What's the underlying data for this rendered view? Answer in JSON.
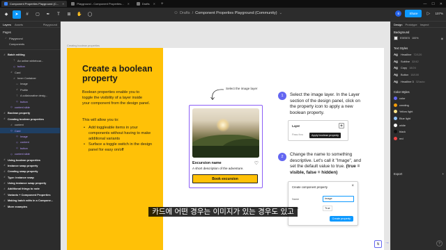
{
  "browser": {
    "tabs": [
      {
        "label": "Component Properties Playground (C...",
        "active": true
      },
      {
        "label": "Playground - Component Properties...",
        "active": false
      },
      {
        "label": "Drafts",
        "active": false
      }
    ]
  },
  "toolbar": {
    "breadcrumb_parent": "Drafts",
    "breadcrumb_separator": "/",
    "file_name": "Component Properties Playground (Community)",
    "avatar_initial": "E",
    "share_label": "Share",
    "zoom": "107%"
  },
  "layers_panel": {
    "tab_layers": "Layers",
    "tab_assets": "Assets",
    "page_label": "Playground",
    "pages_title": "Pages",
    "pages": [
      "Playground",
      "Components"
    ],
    "rows": [
      {
        "label": "Batch editing",
        "style": "bold",
        "indent": 0,
        "icon": "#"
      },
      {
        "label": "An online whiteboar...",
        "style": "",
        "indent": 14,
        "icon": "T"
      },
      {
        "label": "button",
        "style": "purple",
        "indent": 14,
        "icon": "◇"
      },
      {
        "label": "Card",
        "style": "",
        "indent": 10,
        "icon": "#"
      },
      {
        "label": "Inner Container",
        "style": "",
        "indent": 14,
        "icon": "#"
      },
      {
        "label": "Image",
        "style": "",
        "indent": 18,
        "icon": "▭"
      },
      {
        "label": "Profile",
        "style": "",
        "indent": 18,
        "icon": "#"
      },
      {
        "label": "A collaborative desig...",
        "style": "",
        "indent": 18,
        "icon": "T"
      },
      {
        "label": "button",
        "style": "purple",
        "indent": 18,
        "icon": "◇"
      },
      {
        "label": "content slide",
        "style": "purple",
        "indent": 10,
        "icon": "◇"
      },
      {
        "label": "Boolean property",
        "style": "bold",
        "indent": 0,
        "icon": "#"
      },
      {
        "label": "Creating boolean properties",
        "style": "bold",
        "indent": 0,
        "icon": "#"
      },
      {
        "label": "content",
        "style": "",
        "indent": 10,
        "icon": "#"
      },
      {
        "label": "Card",
        "style": "purple sel",
        "indent": 10,
        "icon": "◇"
      },
      {
        "label": "Image",
        "style": "purple",
        "indent": 18,
        "icon": "◇"
      },
      {
        "label": "content",
        "style": "purple",
        "indent": 18,
        "icon": "◇"
      },
      {
        "label": "button",
        "style": "purple",
        "indent": 18,
        "icon": "◇"
      },
      {
        "label": "content slide",
        "style": "purple",
        "indent": 10,
        "icon": "◇"
      },
      {
        "label": "Using boolean properties",
        "style": "bold",
        "indent": 0,
        "icon": "#"
      },
      {
        "label": "Instance swap property",
        "style": "bold",
        "indent": 0,
        "icon": "#"
      },
      {
        "label": "Creating swap property",
        "style": "bold",
        "indent": 0,
        "icon": "#"
      },
      {
        "label": "Type: instance swap",
        "style": "bold",
        "indent": 0,
        "icon": "#"
      },
      {
        "label": "Using instance swap property",
        "style": "bold",
        "indent": 0,
        "icon": "#"
      },
      {
        "label": "Additional things to note",
        "style": "bold",
        "indent": 0,
        "icon": "#"
      },
      {
        "label": "Variants + Component Properties",
        "style": "bold",
        "indent": 0,
        "icon": "#"
      },
      {
        "label": "Making batch edits in a Compone...",
        "style": "bold",
        "indent": 0,
        "icon": "#"
      },
      {
        "label": "More examples",
        "style": "bold",
        "indent": 0,
        "icon": "#"
      }
    ]
  },
  "canvas": {
    "frame_label": "Creating boolean properties",
    "heading": "Create a boolean property",
    "intro": "Boolean properties enable you to toggle the visibility of a layer inside your component from the design panel.",
    "allow_intro": "This will allow you to:",
    "bullets": [
      "Add toggleable items in your components without having to make additional variants",
      "Surface a toggle switch in the design panel for easy on/off"
    ],
    "arrow_label": "Select the image layer",
    "card": {
      "title": "Excursion name",
      "description": "A short description of the adventure.",
      "button": "Book excursion"
    },
    "steps": [
      {
        "number": "1",
        "text": "Select the image layer. In the Layer section of the design panel, click on the property icon to apply a new boolean property."
      },
      {
        "number": "2",
        "text": "Change the name to something descriptive. Let's call it \"Image\", and set the default value to true.",
        "emphasis": "(true = visible, false = hidden)"
      }
    ],
    "mini_layer": {
      "label": "Layer",
      "pass": "Pass thro",
      "tooltip": "Apply boolean property"
    },
    "mini_dialog": {
      "title": "Create component property",
      "name_label": "Name",
      "name_value": "Image",
      "value_label": "Value",
      "value_value": "True",
      "create_button": "Create property"
    },
    "next_badge": "N",
    "subtitle": "카드에 어떤 경우는 이미지가 있는 경우도 있고"
  },
  "design_panel": {
    "tab_design": "Design",
    "tab_prototype": "Prototype",
    "tab_inspect": "Inspect",
    "background_title": "Background",
    "background_hex": "E5E5E5",
    "background_opacity": "100%",
    "text_styles_title": "Text Styles",
    "text_styles": [
      {
        "name": "Headline",
        "meta": "72/120"
      },
      {
        "name": "Subline",
        "meta": "32/42"
      },
      {
        "name": "Copy",
        "meta": "18/24"
      },
      {
        "name": "Button",
        "meta": "18/100"
      },
      {
        "name": "Headline 3",
        "meta": "32/auto"
      }
    ],
    "color_styles_title": "Color Styles",
    "color_styles": [
      {
        "name": "color",
        "hex": "#6366f1"
      },
      {
        "name": "creating",
        "hex": "#f59e0b"
      },
      {
        "name": "Yellow light",
        "hex": "#fde68a"
      },
      {
        "name": "Blue light",
        "hex": "#93c5fd"
      },
      {
        "name": "white",
        "hex": "#ffffff"
      },
      {
        "name": "black",
        "hex": "#111111"
      },
      {
        "name": "red",
        "hex": "#ef4444"
      }
    ],
    "export_label": "Export",
    "export_add": "+",
    "help": "?"
  }
}
